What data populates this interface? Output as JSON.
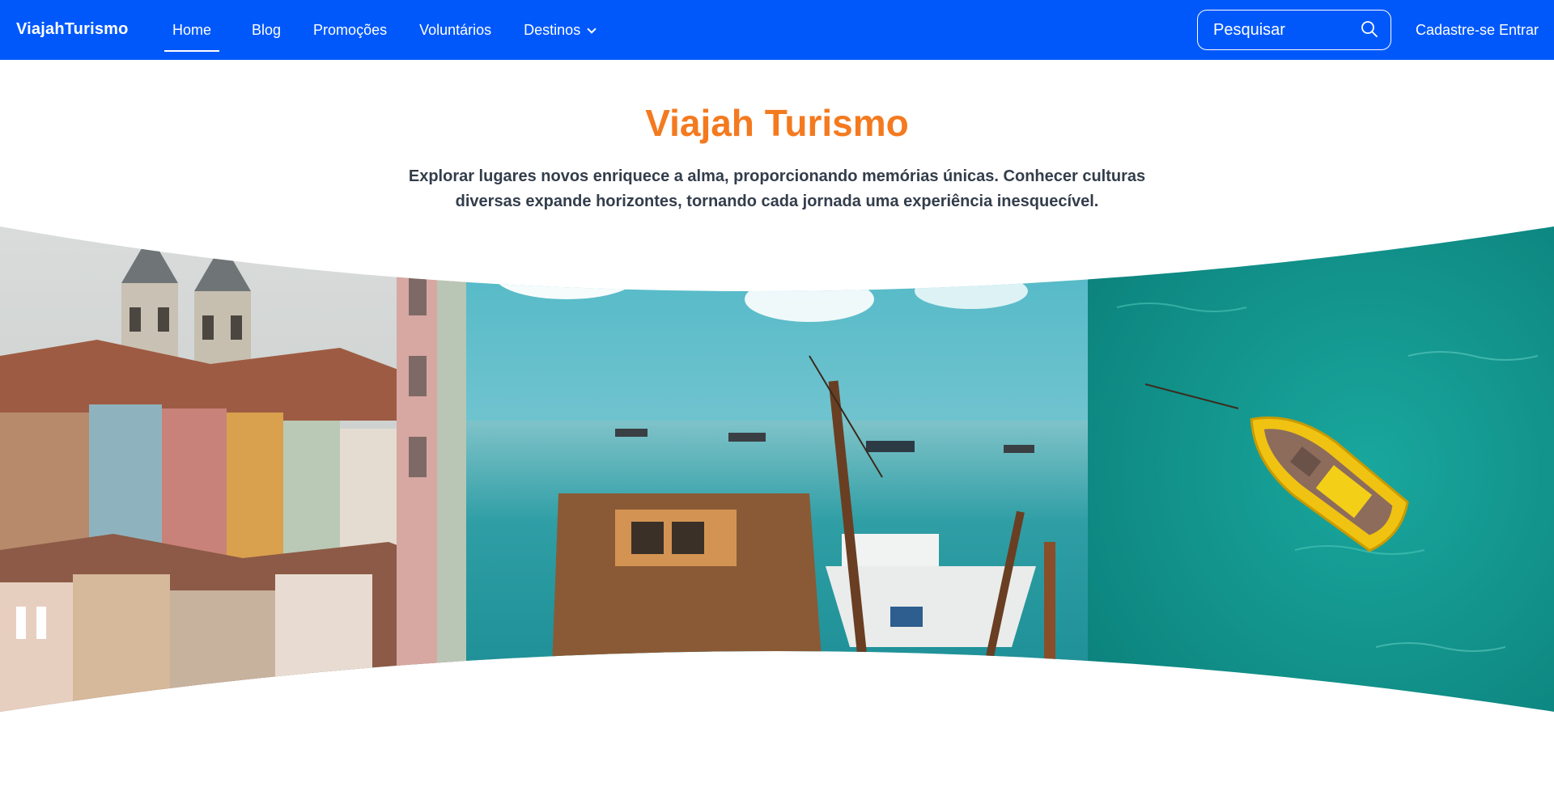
{
  "nav": {
    "brand": "ViajahTurismo",
    "links": [
      {
        "label": "Home",
        "active": true
      },
      {
        "label": "Blog",
        "active": false
      },
      {
        "label": "Promoções",
        "active": false
      },
      {
        "label": "Voluntários",
        "active": false
      },
      {
        "label": "Destinos",
        "active": false,
        "dropdown": true
      }
    ],
    "search_placeholder": "Pesquisar",
    "signup_label": "Cadastre-se",
    "login_label": "Entrar"
  },
  "hero": {
    "title": "Viajah Turismo",
    "description": "Explorar lugares novos enriquece a alma, proporcionando memórias únicas. Conhecer culturas diversas expande horizontes, tornando cada jornada uma experiência inesquecível."
  },
  "colors": {
    "navbar": "#0058fb",
    "accent": "#f47a1f",
    "text": "#333d4b"
  },
  "icons": {
    "search": "search-icon",
    "dropdown": "chevron-down-icon"
  }
}
